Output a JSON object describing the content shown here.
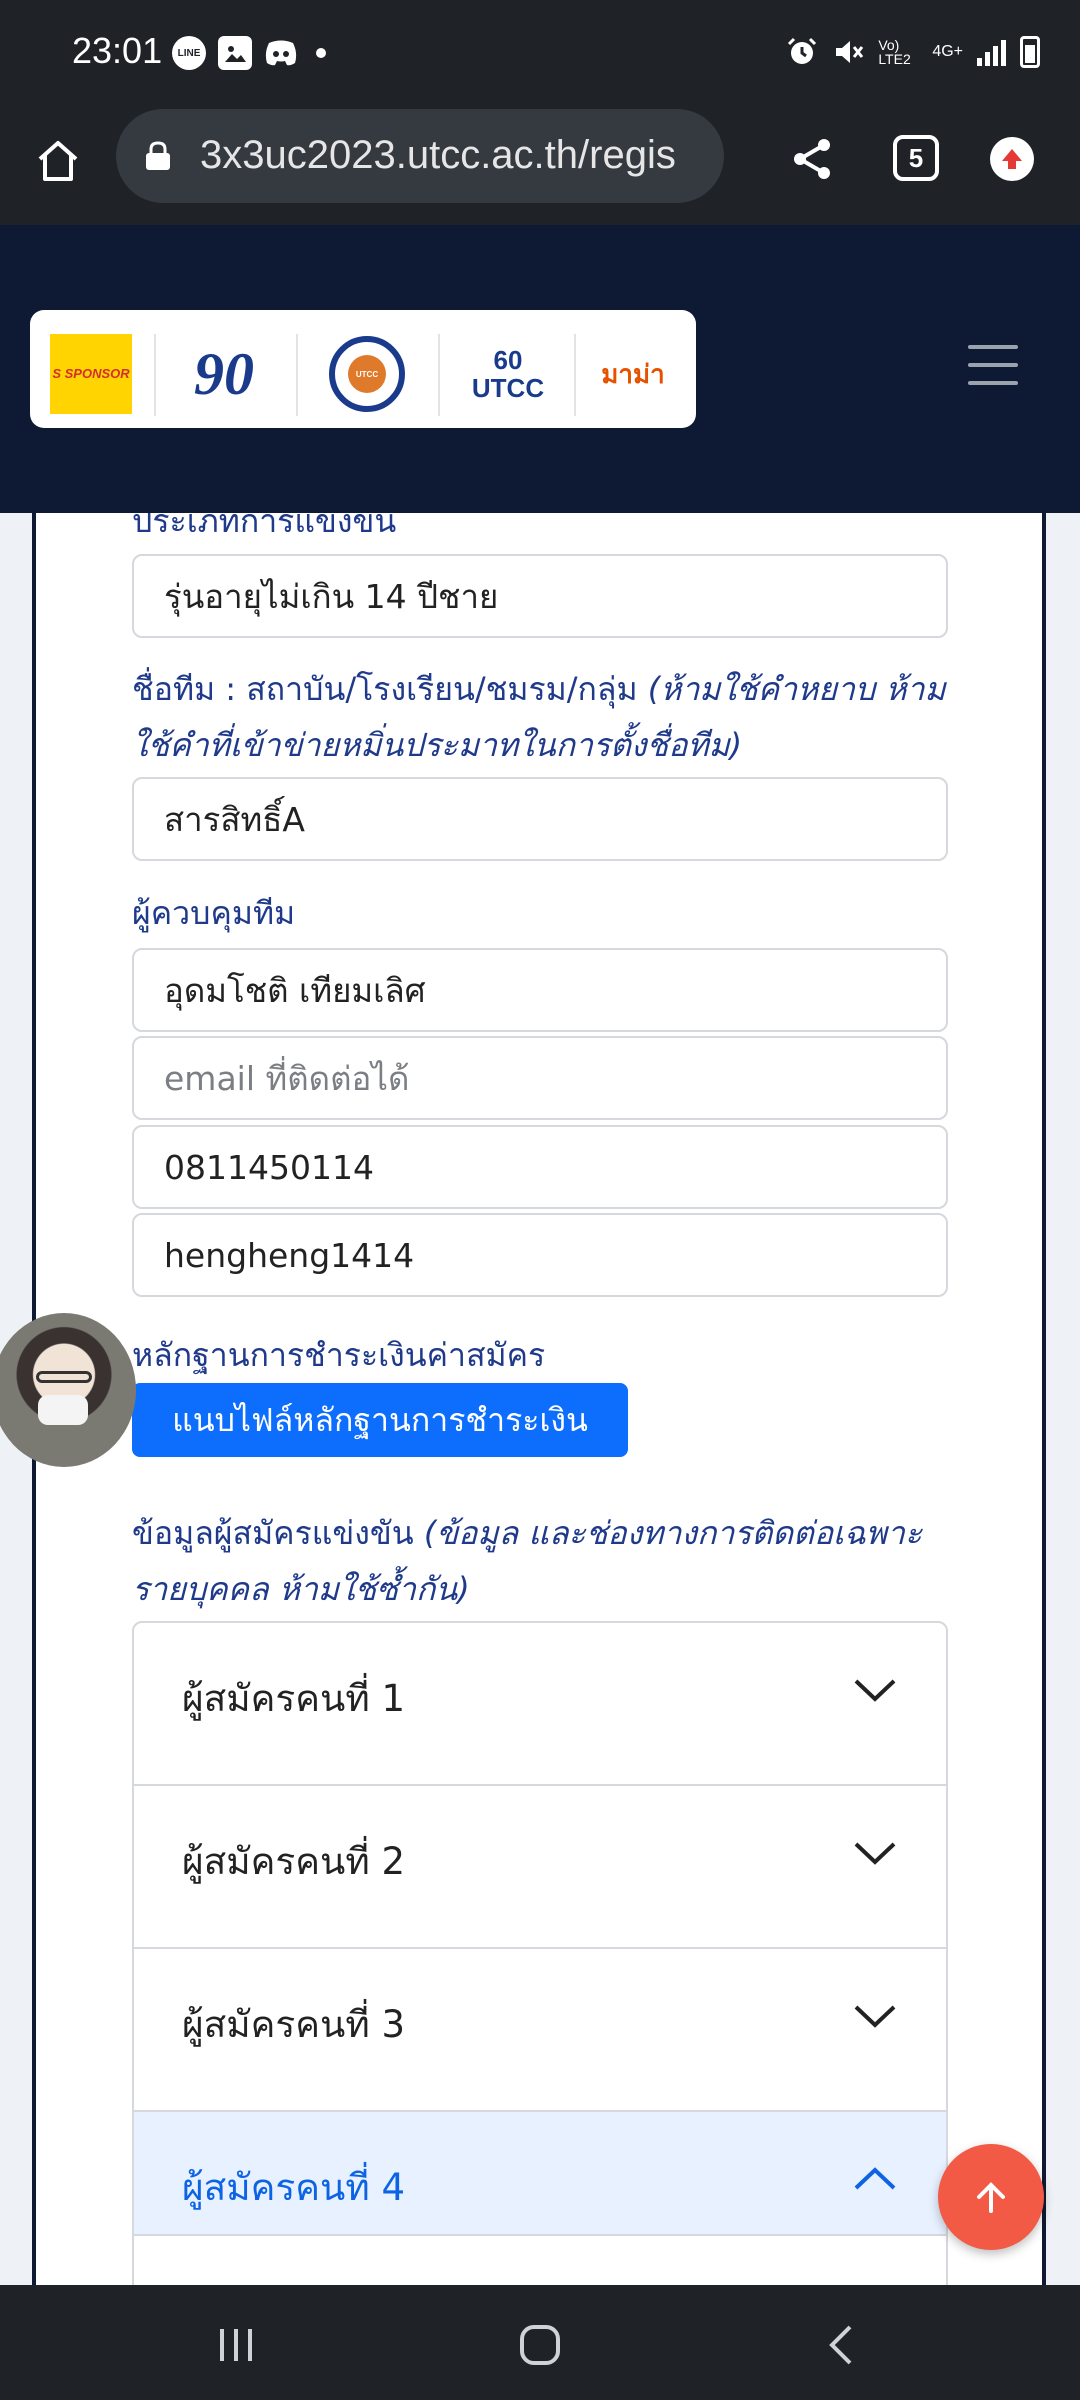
{
  "status_bar": {
    "time": "23:01",
    "left_icons": [
      "line-icon",
      "gallery-icon",
      "discord-icon",
      "dot-icon"
    ],
    "right_text": "Vo) LTE2",
    "network": "4G+",
    "icons": [
      "alarm-icon",
      "mute-icon",
      "signal-icon",
      "battery-icon"
    ]
  },
  "browser": {
    "url": "3x3uc2023.utcc.ac.th/regis",
    "tab_count": "5"
  },
  "header": {
    "logos": [
      "S SPONSOR",
      "90",
      "UTCC",
      "60 UTCC",
      "มาม่า"
    ]
  },
  "form": {
    "competition_type_label": "ประเภทการแข่งขัน",
    "competition_type_value": "รุ่นอายุไม่เกิน 14 ปีชาย",
    "team_name_label": "ชื่อทีม : สถาบัน/โรงเรียน/ชมรม/กลุ่ม",
    "team_name_note_1": "(ห้ามใช้คำหยาบ ห้าม",
    "team_name_note_2": "ใช้คำที่เข้าข่ายหมิ่นประมาทในการตั้งชื่อทีม)",
    "team_name_value": "สารสิทธิ์A",
    "manager_label": "ผู้ควบคุมทีม",
    "manager_name_value": "อุดมโชติ เทียมเลิศ",
    "manager_email_placeholder": "email ที่ติดต่อได้",
    "manager_phone_value": "0811450114",
    "manager_line_value": "hengheng1414",
    "payment_label": "หลักฐานการชำระเงินค่าสมัคร",
    "payment_button": "แนบไฟล์หลักฐานการชำระเงิน",
    "applicants_label": "ข้อมูลผู้สมัครแข่งขัน",
    "applicants_note_1": "(ข้อมูล และช่องทางการติดต่อเฉพาะ",
    "applicants_note_2": "รายบุคคล ห้ามใช้ซ้ำกัน)",
    "applicants": [
      {
        "label": "ผู้สมัครคนที่ 1",
        "expanded": false
      },
      {
        "label": "ผู้สมัครคนที่ 2",
        "expanded": false
      },
      {
        "label": "ผู้สมัครคนที่ 3",
        "expanded": false
      },
      {
        "label": "ผู้สมัครคนที่ 4",
        "expanded": true
      }
    ]
  },
  "colors": {
    "header_bg": "#0e1a34",
    "label_blue": "#1f3a8a",
    "button_blue": "#0d6efd",
    "scroll_top": "#f25a45"
  }
}
